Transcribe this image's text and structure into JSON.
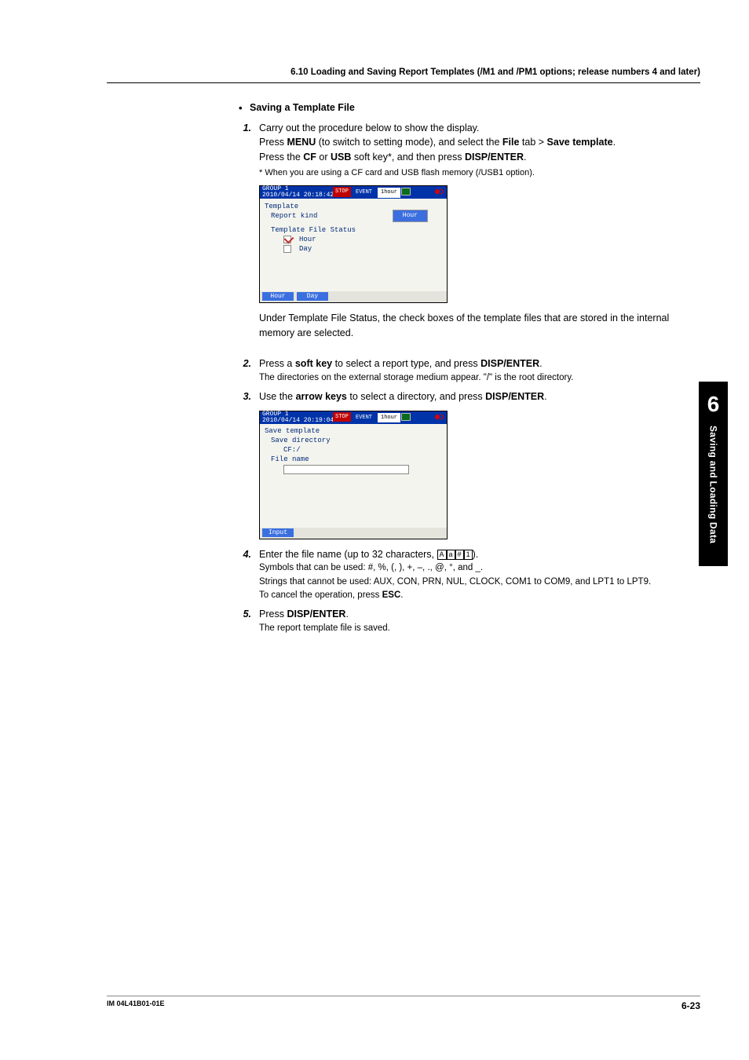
{
  "header": {
    "title": "6.10  Loading and Saving Report Templates (/M1 and /PM1 options; release numbers 4 and later)"
  },
  "side_tab": {
    "chapter": "6",
    "label": "Saving and Loading Data"
  },
  "footer": {
    "left": "IM 04L41B01-01E",
    "right": "6-23"
  },
  "section": {
    "heading_bullet": "•",
    "heading": "Saving a Template File",
    "steps": [
      {
        "num": "1.",
        "lines": [
          {
            "parts": [
              {
                "t": "Carry out the procedure below to show the display."
              }
            ]
          },
          {
            "parts": [
              {
                "t": "Press "
              },
              {
                "t": "MENU",
                "b": true
              },
              {
                "t": " (to switch to setting mode), and select the "
              },
              {
                "t": "File",
                "b": true
              },
              {
                "t": " tab > "
              },
              {
                "t": "Save template",
                "b": true
              },
              {
                "t": "."
              }
            ]
          },
          {
            "parts": [
              {
                "t": "Press the "
              },
              {
                "t": "CF",
                "b": true
              },
              {
                "t": " or "
              },
              {
                "t": "USB",
                "b": true
              },
              {
                "t": " soft key*, and then press "
              },
              {
                "t": "DISP/ENTER",
                "b": true
              },
              {
                "t": "."
              }
            ]
          }
        ],
        "star_note": "*   When you are using a CF card and USB flash memory (/USB1 option).",
        "after": [
          "Under Template File Status, the check boxes of the template files that are stored in the internal memory are selected."
        ]
      },
      {
        "num": "2.",
        "lines": [
          {
            "parts": [
              {
                "t": "Press a "
              },
              {
                "t": "soft key",
                "b": true
              },
              {
                "t": " to select a report type, and press "
              },
              {
                "t": "DISP/ENTER",
                "b": true
              },
              {
                "t": "."
              }
            ]
          }
        ],
        "small_after": "The directories on the external storage medium appear. \"/\" is the root directory."
      },
      {
        "num": "3.",
        "lines": [
          {
            "parts": [
              {
                "t": "Use the "
              },
              {
                "t": "arrow keys",
                "b": true
              },
              {
                "t": " to select a directory, and press "
              },
              {
                "t": "DISP/ENTER",
                "b": true
              },
              {
                "t": "."
              }
            ]
          }
        ]
      },
      {
        "num": "4.",
        "lines": [
          {
            "parts": [
              {
                "t": "Enter the file name (up to 32 characters, "
              },
              {
                "key": "A"
              },
              {
                "key": "a"
              },
              {
                "key": "#"
              },
              {
                "key": "1"
              },
              {
                "t": ")."
              }
            ]
          }
        ],
        "small_lines": [
          "Symbols that can be used: #, %, (, ), +, –, ., @, °, and _.",
          "Strings that cannot be used: AUX, CON, PRN, NUL, CLOCK, COM1 to COM9, and LPT1 to LPT9.",
          "To cancel the operation, press ESC."
        ],
        "small_bold_last": "ESC"
      },
      {
        "num": "5.",
        "lines": [
          {
            "parts": [
              {
                "t": "Press "
              },
              {
                "t": "DISP/ENTER",
                "b": true
              },
              {
                "t": "."
              }
            ]
          }
        ],
        "small_after": "The report template file is saved."
      }
    ]
  },
  "device1": {
    "group": "GROUP 1",
    "datetime": "2010/04/14 20:18:42",
    "stop": "STOP",
    "event": "EVENT",
    "hourtag": "1hour",
    "templates_label": "Template",
    "report_kind_label": "Report kind",
    "report_kind_value": "Hour",
    "status_label": "Template File Status",
    "cb1": "Hour",
    "cb2": "Day",
    "sk1": "Hour",
    "sk2": "Day"
  },
  "device2": {
    "group": "GROUP 1",
    "datetime": "2010/04/14 20:19:04",
    "stop": "STOP",
    "event": "EVENT",
    "hourtag": "1hour",
    "l1": "Save template",
    "l2": "Save directory",
    "l3": "CF:/",
    "l4": "File name",
    "sk1": "Input"
  }
}
